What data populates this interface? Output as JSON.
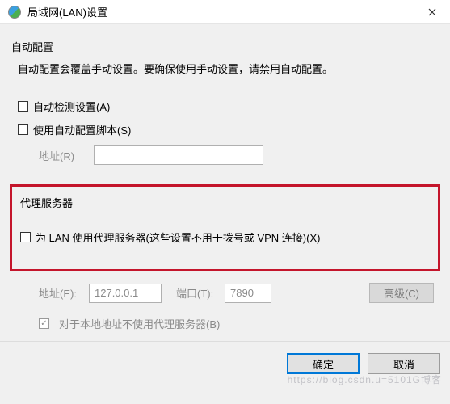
{
  "titlebar": {
    "title": "局域网(LAN)设置"
  },
  "autoConfig": {
    "sectionTitle": "自动配置",
    "description": "自动配置会覆盖手动设置。要确保使用手动设置，请禁用自动配置。",
    "autoDetectLabel": "自动检测设置(A)",
    "useScriptLabel": "使用自动配置脚本(S)",
    "addressLabel": "地址(R)",
    "addressValue": ""
  },
  "proxy": {
    "sectionTitle": "代理服务器",
    "useProxyLabel": "为 LAN 使用代理服务器(这些设置不用于拨号或 VPN 连接)(X)",
    "addressLabel": "地址(E):",
    "addressValue": "127.0.0.1",
    "portLabel": "端口(T):",
    "portValue": "7890",
    "advancedLabel": "高级(C)",
    "bypassLocalLabel": "对于本地地址不使用代理服务器(B)"
  },
  "buttons": {
    "ok": "确定",
    "cancel": "取消"
  },
  "watermark": "https://blog.csdn.u=5101G博客"
}
